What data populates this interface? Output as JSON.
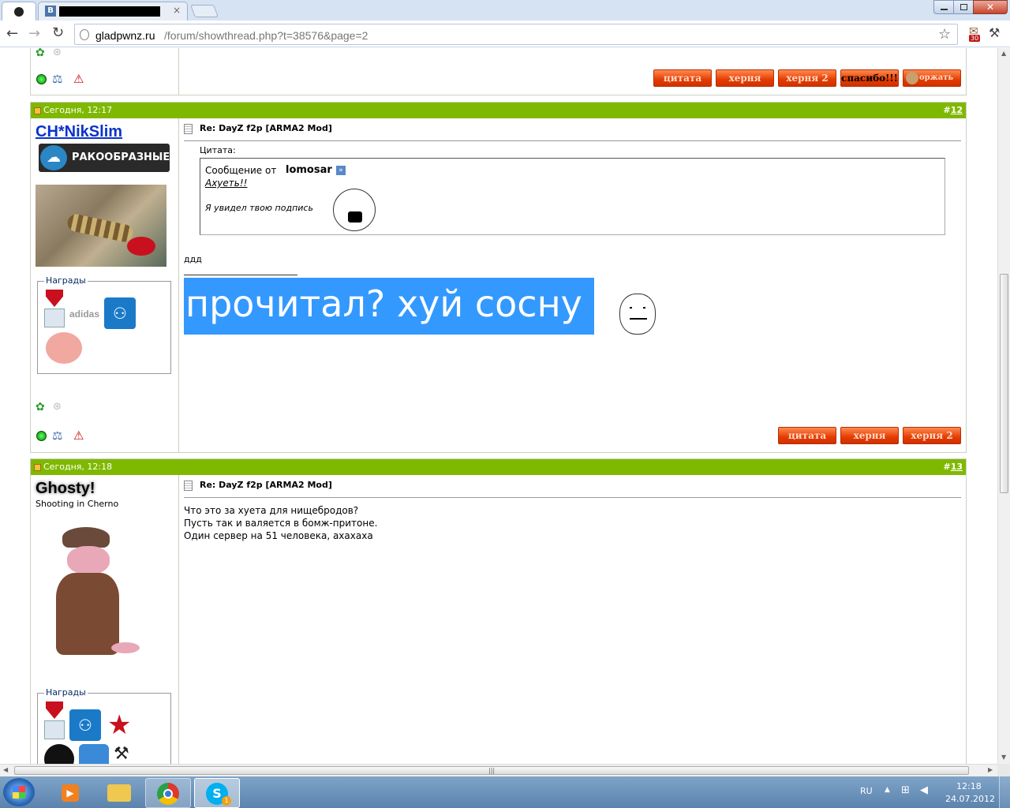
{
  "browser": {
    "tab1_title": "",
    "url_domain": "gladpwnz.ru",
    "url_path": "/forum/showthread.php?t=38576&page=2",
    "ext_badge": "30"
  },
  "posts": {
    "top_buttons": [
      "цитата",
      "херня",
      "херня 2",
      "спасибо!!!",
      "оржать"
    ],
    "p12": {
      "date": "Сегодня, 12:17",
      "number_prefix": "#",
      "number": "12",
      "username": "CH*NikSlim",
      "clan_badge": "РАКООБРАЗНЫЕ",
      "awards_label": "Награды",
      "title": "Re: DayZ f2p [ARMA2 Mod]",
      "quote_label": "Цитата:",
      "quote_from": "Сообщение от",
      "quote_author": "lomosar",
      "quote_line1": "Ахуеть!!",
      "quote_line2": "Я увидел твою подпись",
      "body": "ддд",
      "signature": "прочитал? хуй сосну",
      "buttons": [
        "цитата",
        "херня",
        "херня 2"
      ]
    },
    "p13": {
      "date": "Сегодня, 12:18",
      "number_prefix": "#",
      "number": "13",
      "username": "Ghosty!",
      "user_title": "Shooting in Cherno",
      "awards_label": "Награды",
      "title": "Re: DayZ f2p [ARMA2 Mod]",
      "line1": "Что это за хуета для нищебродов?",
      "line2": "Пусть так и валяется в бомж-притоне.",
      "line3": "Один сервер на 51 человека, ахахаха"
    }
  },
  "taskbar": {
    "lang": "RU",
    "time": "12:18",
    "date": "24.07.2012",
    "skype_badge": "1"
  },
  "colors": {
    "post_header": "#7fb800",
    "link_blue": "#0a33cc",
    "selection": "#3399ff",
    "button_red": "#e43c00"
  }
}
